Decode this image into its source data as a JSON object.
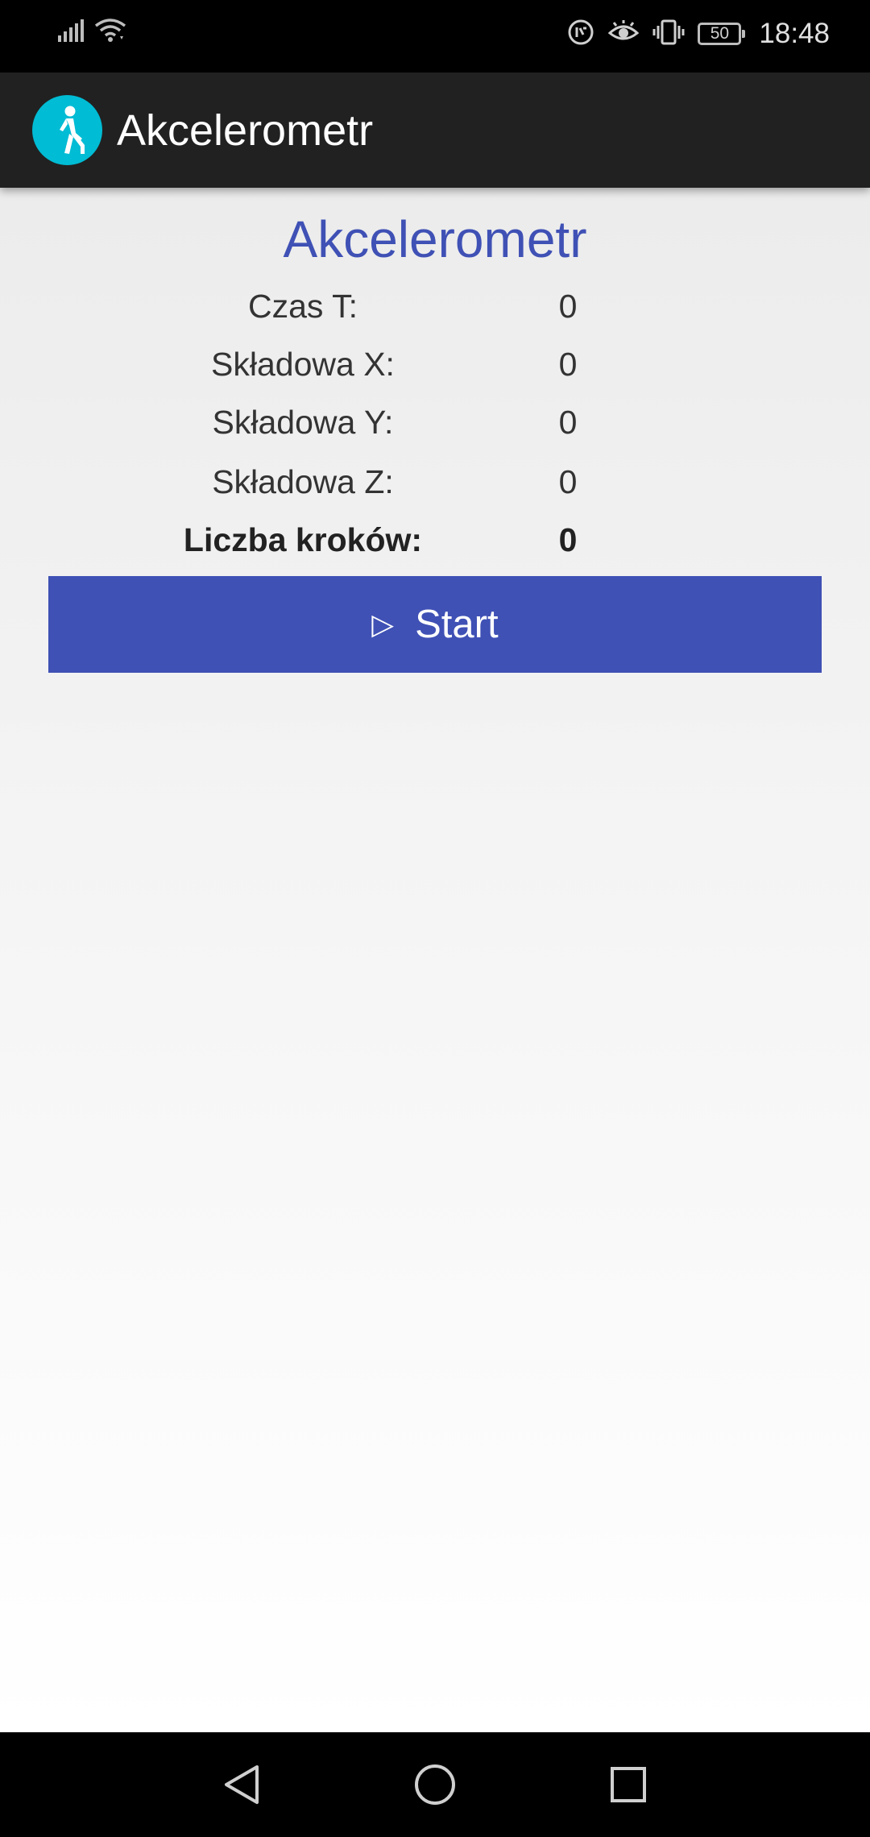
{
  "status_bar": {
    "time": "18:48",
    "battery": "50",
    "icons": [
      "signal-icon",
      "wifi-icon",
      "data-saver-icon",
      "eye-comfort-icon",
      "vibrate-icon",
      "battery-icon"
    ]
  },
  "app_bar": {
    "title": "Akcelerometr",
    "logo_icon": "walking-person-icon",
    "logo_color": "#00bcd4"
  },
  "main": {
    "heading": "Akcelerometr",
    "rows": [
      {
        "label": "Czas T:",
        "value": "0"
      },
      {
        "label": "Składowa X:",
        "value": "0"
      },
      {
        "label": "Składowa Y:",
        "value": "0"
      },
      {
        "label": "Składowa Z:",
        "value": "0"
      },
      {
        "label": "Liczba kroków:",
        "value": "0"
      }
    ],
    "start_button": {
      "label": "Start",
      "icon": "play-icon"
    }
  },
  "nav_bar": {
    "buttons": [
      "back-icon",
      "home-icon",
      "recents-icon"
    ]
  },
  "colors": {
    "accent": "#3f51b5",
    "app_bar": "#212121",
    "logo": "#00bcd4"
  }
}
